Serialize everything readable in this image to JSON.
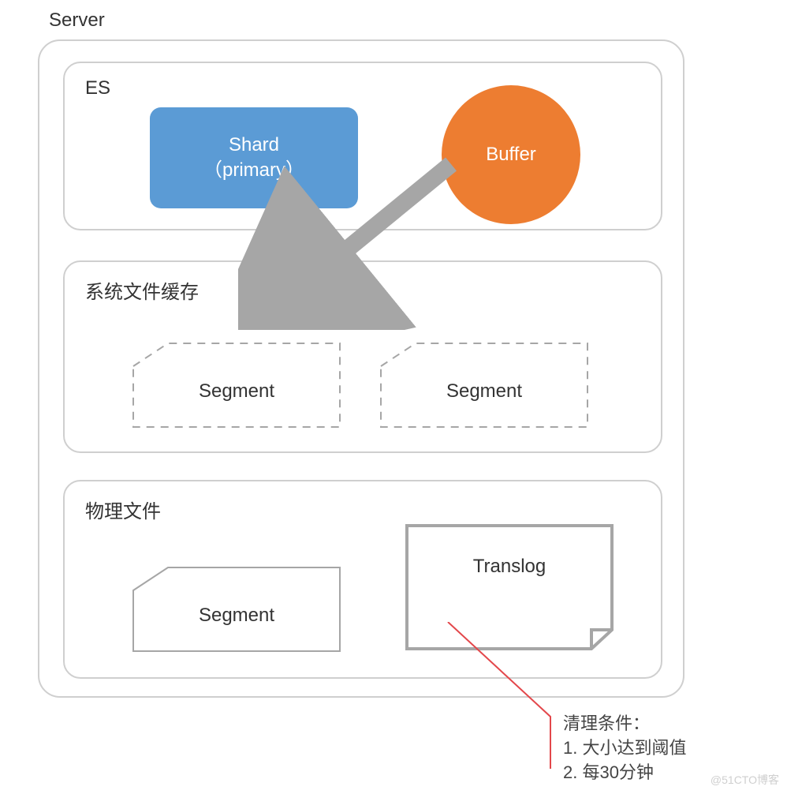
{
  "server_label": "Server",
  "es": {
    "label": "ES",
    "shard_line1": "Shard",
    "shard_line2": "（primary）",
    "buffer": "Buffer"
  },
  "cache": {
    "label": "系统文件缓存",
    "segment1": "Segment",
    "segment2": "Segment"
  },
  "physical": {
    "label": "物理文件",
    "segment": "Segment",
    "translog": "Translog"
  },
  "callout": {
    "title": "清理条件：",
    "item1": "1. 大小达到阈值",
    "item2": "2. 每30分钟"
  },
  "watermark": "@51CTO博客",
  "colors": {
    "shard": "#5b9bd5",
    "buffer": "#ed7d31",
    "border": "#cfcfcf",
    "arrow": "#a6a6a6",
    "callout_line": "#e3474b"
  }
}
